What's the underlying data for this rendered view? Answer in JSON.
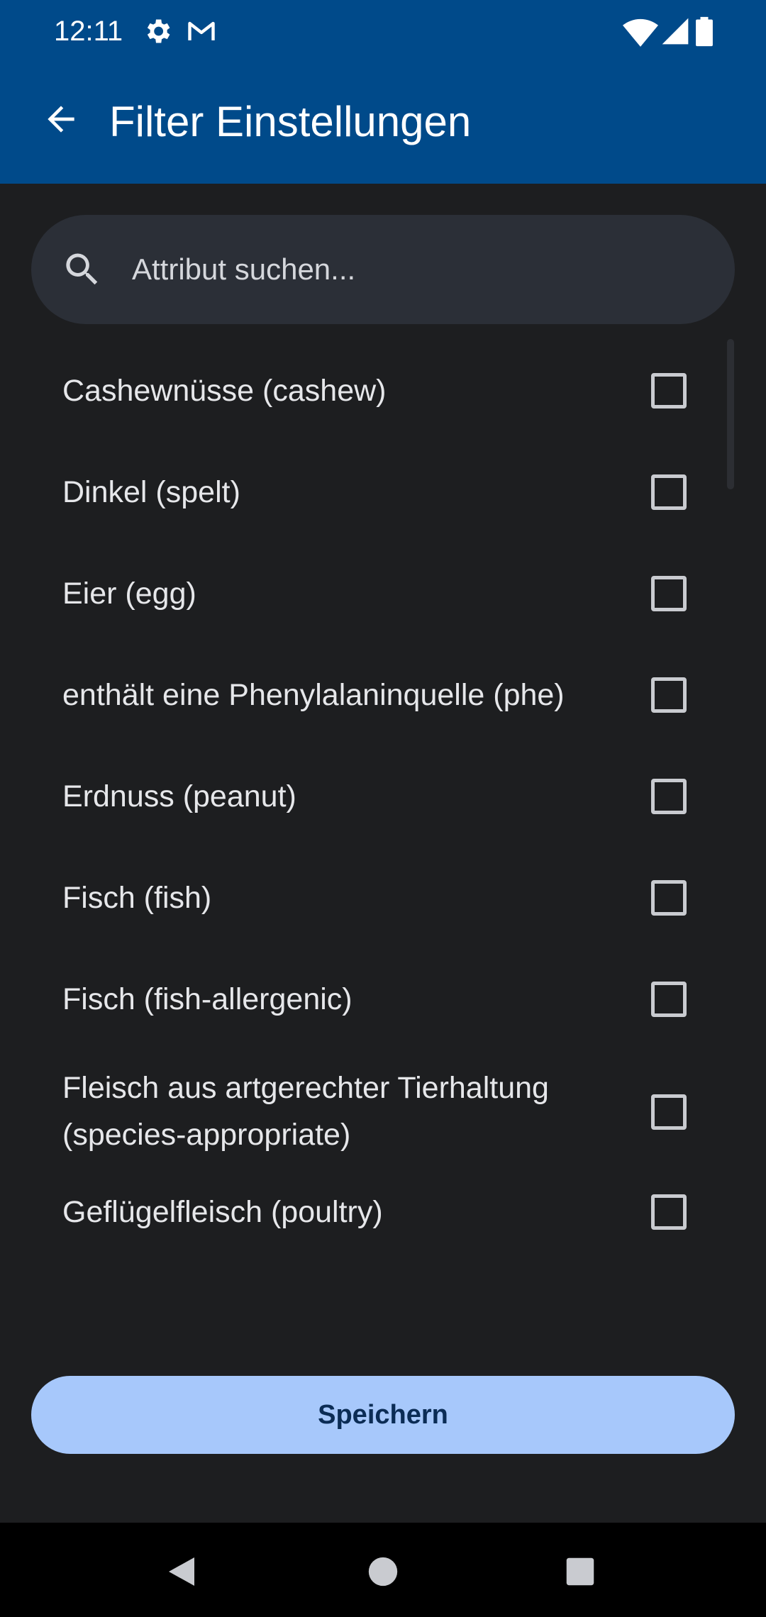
{
  "status_bar": {
    "time": "12:11",
    "icons": [
      "settings-icon",
      "gmail-icon",
      "wifi-icon",
      "signal-icon",
      "battery-icon"
    ]
  },
  "app_bar": {
    "back_icon": "arrow-left-icon",
    "title": "Filter Einstellungen"
  },
  "search": {
    "icon": "search-icon",
    "placeholder": "Attribut suchen...",
    "value": ""
  },
  "items": [
    {
      "label": "Cashewnüsse (cashew)",
      "checked": false
    },
    {
      "label": "Dinkel (spelt)",
      "checked": false
    },
    {
      "label": "Eier (egg)",
      "checked": false
    },
    {
      "label": "enthält eine Phenylalaninquelle (phe)",
      "checked": false
    },
    {
      "label": "Erdnuss (peanut)",
      "checked": false
    },
    {
      "label": "Fisch (fish)",
      "checked": false
    },
    {
      "label": "Fisch (fish-allergenic)",
      "checked": false
    },
    {
      "label": "Fleisch aus artgerechter Tierhaltung (species-appropriate)",
      "checked": false
    },
    {
      "label": "Geflügelfleisch (poultry)",
      "checked": false
    }
  ],
  "save_button": {
    "label": "Speichern"
  },
  "nav_bar": {
    "buttons": [
      "back-triangle-icon",
      "home-circle-icon",
      "recents-square-icon"
    ]
  },
  "colors": {
    "app_bar": "#004a8a",
    "background": "#1d1e20",
    "search_bg": "#2b2f37",
    "save_button_bg": "#a7c8fb",
    "save_button_text": "#0b2c55"
  }
}
